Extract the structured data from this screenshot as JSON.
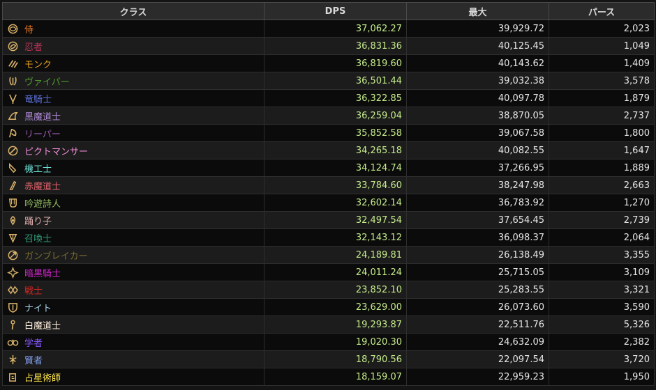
{
  "headers": [
    "クラス",
    "DPS",
    "最大",
    "パース"
  ],
  "rows": [
    {
      "job": "侍",
      "color": "#f07a22",
      "icon": "samurai-icon",
      "dps": "37,062.27",
      "max": "39,929.72",
      "parses": "2,023"
    },
    {
      "job": "忍者",
      "color": "#b73259",
      "icon": "ninja-icon",
      "dps": "36,831.36",
      "max": "40,125.45",
      "parses": "1,049"
    },
    {
      "job": "モンク",
      "color": "#e39d22",
      "icon": "monk-icon",
      "dps": "36,819.60",
      "max": "40,143.62",
      "parses": "1,409"
    },
    {
      "job": "ヴァイパー",
      "color": "#4f9a2d",
      "icon": "viper-icon",
      "dps": "36,501.44",
      "max": "39,032.38",
      "parses": "3,578"
    },
    {
      "job": "竜騎士",
      "color": "#5b6fd8",
      "icon": "dragoon-icon",
      "dps": "36,322.85",
      "max": "40,097.78",
      "parses": "1,879"
    },
    {
      "job": "黒魔道士",
      "color": "#b08ad8",
      "icon": "black-mage-icon",
      "dps": "36,259.04",
      "max": "38,870.05",
      "parses": "2,737"
    },
    {
      "job": "リーパー",
      "color": "#9a5bb0",
      "icon": "reaper-icon",
      "dps": "35,852.58",
      "max": "39,067.58",
      "parses": "1,800"
    },
    {
      "job": "ピクトマンサー",
      "color": "#f08cd9",
      "icon": "pictomancer-icon",
      "dps": "34,265.18",
      "max": "40,082.55",
      "parses": "1,647"
    },
    {
      "job": "機工士",
      "color": "#6ee1d6",
      "icon": "machinist-icon",
      "dps": "34,124.74",
      "max": "37,266.95",
      "parses": "1,889"
    },
    {
      "job": "赤魔道士",
      "color": "#e3636c",
      "icon": "red-mage-icon",
      "dps": "33,784.60",
      "max": "38,247.98",
      "parses": "2,663"
    },
    {
      "job": "吟遊詩人",
      "color": "#91ba5e",
      "icon": "bard-icon",
      "dps": "32,602.14",
      "max": "36,783.92",
      "parses": "1,270"
    },
    {
      "job": "踊り子",
      "color": "#e2b0af",
      "icon": "dancer-icon",
      "dps": "32,497.54",
      "max": "37,654.45",
      "parses": "2,739"
    },
    {
      "job": "召喚士",
      "color": "#2d9b78",
      "icon": "summoner-icon",
      "dps": "32,143.12",
      "max": "36,098.37",
      "parses": "2,064"
    },
    {
      "job": "ガンブレイカー",
      "color": "#796d30",
      "icon": "gunbreaker-icon",
      "dps": "24,189.81",
      "max": "26,138.49",
      "parses": "3,355"
    },
    {
      "job": "暗黒騎士",
      "color": "#d126cc",
      "icon": "dark-knight-icon",
      "dps": "24,011.24",
      "max": "25,715.05",
      "parses": "3,109"
    },
    {
      "job": "戦士",
      "color": "#cf2621",
      "icon": "warrior-icon",
      "dps": "23,852.10",
      "max": "25,283.55",
      "parses": "3,321"
    },
    {
      "job": "ナイト",
      "color": "#a8d2e6",
      "icon": "paladin-icon",
      "dps": "23,629.00",
      "max": "26,073.60",
      "parses": "3,590"
    },
    {
      "job": "白魔道士",
      "color": "#fff0dc",
      "icon": "white-mage-icon",
      "dps": "19,293.87",
      "max": "22,511.76",
      "parses": "5,326"
    },
    {
      "job": "学者",
      "color": "#8657ff",
      "icon": "scholar-icon",
      "dps": "19,020.30",
      "max": "24,632.09",
      "parses": "2,382"
    },
    {
      "job": "賢者",
      "color": "#80a0f0",
      "icon": "sage-icon",
      "dps": "18,790.56",
      "max": "22,097.54",
      "parses": "3,720"
    },
    {
      "job": "占星術師",
      "color": "#ffe74a",
      "icon": "astrologian-icon",
      "dps": "18,159.07",
      "max": "22,959.23",
      "parses": "1,950"
    }
  ]
}
